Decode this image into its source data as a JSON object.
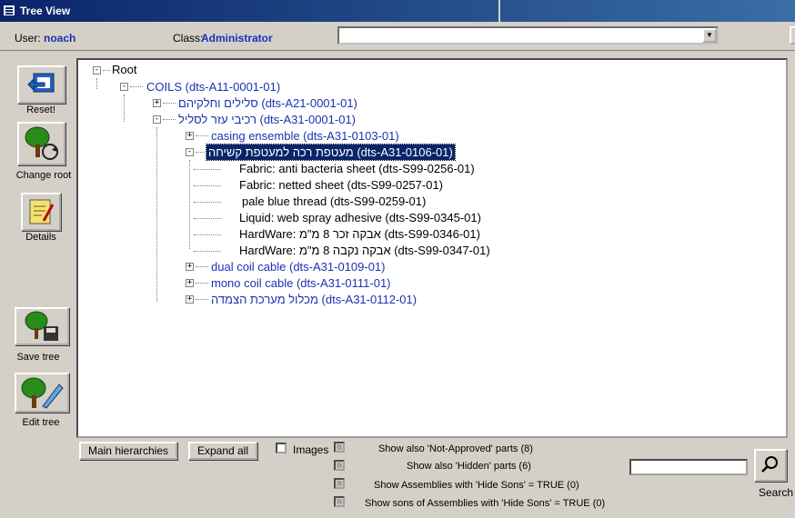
{
  "window": {
    "title": "Tree View"
  },
  "header": {
    "user_label": "User:",
    "user_value": "noach",
    "class_label": "Class:",
    "class_value": "Administrator",
    "class_select_value": ""
  },
  "sidebar": {
    "reset": "Reset!",
    "change_root": "Change root",
    "details": "Details",
    "save_tree": "Save tree",
    "edit_tree": "Edit tree"
  },
  "tree": {
    "root": "Root",
    "coils": "COILS  (dts-A11-0001-01)",
    "n1": "סלילים וחלקיהם  (dts-A21-0001-01)",
    "n2": "רכיבי עזר לסליל  (dts-A31-0001-01)",
    "n3": "casing ensemble  (dts-A31-0103-01)",
    "n4": "מעטפת רכה למעטפת קשיחה  (dts-A31-0106-01)",
    "c1": "Fabric:  anti bacteria sheet  (dts-S99-0256-01)",
    "c2": "Fabric:  netted sheet  (dts-S99-0257-01)",
    "c3": "pale blue thread  (dts-S99-0259-01)",
    "c4": "Liquid:  web spray adhesive  (dts-S99-0345-01)",
    "c5": "HardWare:  אבקה זכר 8 מ\"מ  (dts-S99-0346-01)",
    "c6": "HardWare:  אבקה נקבה 8 מ\"מ  (dts-S99-0347-01)",
    "n5": "dual coil cable  (dts-A31-0109-01)",
    "n6": "mono coil cable  (dts-A31-0111-01)",
    "n7": "מכלול מערכת הצמדה  (dts-A31-0112-01)"
  },
  "bottom": {
    "main_hierarchies": "Main hierarchies",
    "expand_all": "Expand all",
    "images": "Images",
    "opt1": "Show also 'Not-Approved' parts (8)",
    "opt2": "Show also 'Hidden' parts (6)",
    "opt3": "Show Assemblies with 'Hide Sons' = TRUE (0)",
    "opt4": "Show sons of Assemblies with 'Hide Sons' = TRUE (0)",
    "search_value": "",
    "search_label": "Search"
  }
}
